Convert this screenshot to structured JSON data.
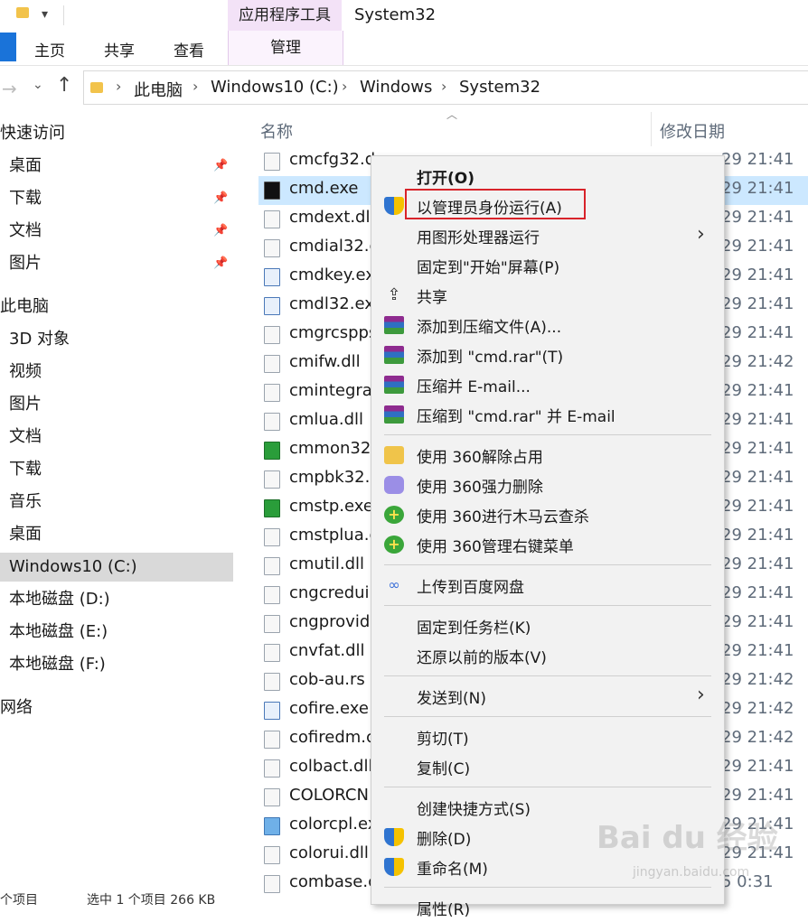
{
  "ribbon": {
    "window_title": "System32",
    "context_group_label": "应用程序工具",
    "tabs": [
      "主页",
      "共享",
      "查看"
    ],
    "context_tab": "管理"
  },
  "address": {
    "crumbs": [
      "此电脑",
      "Windows10 (C:)",
      "Windows",
      "System32"
    ]
  },
  "sidebar": {
    "items": [
      {
        "label": "快速访问",
        "head": true
      },
      {
        "label": "桌面",
        "pinned": true
      },
      {
        "label": "下载",
        "pinned": true
      },
      {
        "label": "文档",
        "pinned": true
      },
      {
        "label": "图片",
        "pinned": true
      },
      {
        "label": "此电脑",
        "head": true
      },
      {
        "label": "3D 对象"
      },
      {
        "label": "视频"
      },
      {
        "label": "图片"
      },
      {
        "label": "文档"
      },
      {
        "label": "下载"
      },
      {
        "label": "音乐"
      },
      {
        "label": "桌面"
      },
      {
        "label": "Windows10 (C:)",
        "selected": true
      },
      {
        "label": "本地磁盘 (D:)"
      },
      {
        "label": "本地磁盘 (E:)"
      },
      {
        "label": "本地磁盘 (F:)"
      },
      {
        "label": "网络",
        "head": true
      }
    ]
  },
  "columns": {
    "name": "名称",
    "date": "修改日期"
  },
  "files": [
    {
      "name": "cmcfg32.d",
      "date": "29 21:41",
      "icon": "dll"
    },
    {
      "name": "cmd.exe",
      "date": "29 21:41",
      "icon": "cmd",
      "selected": true
    },
    {
      "name": "cmdext.dll",
      "date": "29 21:41",
      "icon": "dll"
    },
    {
      "name": "cmdial32.c",
      "date": "29 21:41",
      "icon": "dll"
    },
    {
      "name": "cmdkey.ex",
      "date": "29 21:41",
      "icon": "app"
    },
    {
      "name": "cmdl32.ex",
      "date": "29 21:41",
      "icon": "app"
    },
    {
      "name": "cmgrcspps",
      "date": "29 21:41",
      "icon": "dll"
    },
    {
      "name": "cmifw.dll",
      "date": "29 21:42",
      "icon": "dll"
    },
    {
      "name": "cmintegra",
      "date": "29 21:41",
      "icon": "dll"
    },
    {
      "name": "cmlua.dll",
      "date": "29 21:41",
      "icon": "dll"
    },
    {
      "name": "cmmon32.",
      "date": "29 21:41",
      "icon": "green"
    },
    {
      "name": "cmpbk32.c",
      "date": "29 21:41",
      "icon": "dll"
    },
    {
      "name": "cmstp.exe",
      "date": "29 21:41",
      "icon": "green"
    },
    {
      "name": "cmstplua.c",
      "date": "29 21:41",
      "icon": "dll"
    },
    {
      "name": "cmutil.dll",
      "date": "29 21:41",
      "icon": "dll"
    },
    {
      "name": "cngcredui.",
      "date": "29 21:41",
      "icon": "dll"
    },
    {
      "name": "cngprovid",
      "date": "29 21:41",
      "icon": "dll"
    },
    {
      "name": "cnvfat.dll",
      "date": "29 21:41",
      "icon": "dll"
    },
    {
      "name": "cob-au.rs",
      "date": "29 21:42",
      "icon": "blank"
    },
    {
      "name": "cofire.exe",
      "date": "29 21:42",
      "icon": "app"
    },
    {
      "name": "cofiredm.c",
      "date": "29 21:42",
      "icon": "dll"
    },
    {
      "name": "colbact.dll",
      "date": "29 21:41",
      "icon": "dll"
    },
    {
      "name": "COLORCN",
      "date": "29 21:41",
      "icon": "blank"
    },
    {
      "name": "colorcpl.ex",
      "date": "29 21:41",
      "icon": "color"
    },
    {
      "name": "colorui.dll",
      "date": "29 21:41",
      "icon": "dll"
    },
    {
      "name": "combase.c",
      "date": "5 0:31",
      "icon": "dll"
    }
  ],
  "menu": [
    {
      "label": "打开(O)",
      "bold": true,
      "icon": ""
    },
    {
      "label": "以管理员身份运行(A)",
      "icon": "shield"
    },
    {
      "label": "用图形处理器运行",
      "icon": "",
      "submenu": true
    },
    {
      "label": "固定到\"开始\"屏幕(P)",
      "icon": ""
    },
    {
      "label": "共享",
      "icon": "share"
    },
    {
      "label": "添加到压缩文件(A)...",
      "icon": "rar"
    },
    {
      "label": "添加到 \"cmd.rar\"(T)",
      "icon": "rar"
    },
    {
      "label": "压缩并 E-mail...",
      "icon": "rar"
    },
    {
      "label": "压缩到 \"cmd.rar\" 并 E-mail",
      "icon": "rar"
    },
    {
      "sep": true
    },
    {
      "label": "使用 360解除占用",
      "icon": "360y"
    },
    {
      "label": "使用 360强力删除",
      "icon": "360p"
    },
    {
      "label": "使用 360进行木马云查杀",
      "icon": "360g"
    },
    {
      "label": "使用 360管理右键菜单",
      "icon": "360g"
    },
    {
      "sep": true
    },
    {
      "label": "上传到百度网盘",
      "icon": "baidu"
    },
    {
      "sep": true
    },
    {
      "label": "固定到任务栏(K)",
      "icon": ""
    },
    {
      "label": "还原以前的版本(V)",
      "icon": ""
    },
    {
      "sep": true
    },
    {
      "label": "发送到(N)",
      "icon": "",
      "submenu": true
    },
    {
      "sep": true
    },
    {
      "label": "剪切(T)",
      "icon": ""
    },
    {
      "label": "复制(C)",
      "icon": ""
    },
    {
      "sep": true
    },
    {
      "label": "创建快捷方式(S)",
      "icon": ""
    },
    {
      "label": "删除(D)",
      "icon": "shield"
    },
    {
      "label": "重命名(M)",
      "icon": "shield"
    },
    {
      "sep": true
    },
    {
      "label": "属性(R)",
      "icon": ""
    }
  ],
  "status": {
    "items_text": "个项目",
    "selected_text": "选中 1 个项目 266 KB"
  },
  "watermark": {
    "text": "Bai du 经验",
    "sub": "jingyan.baidu.com"
  }
}
